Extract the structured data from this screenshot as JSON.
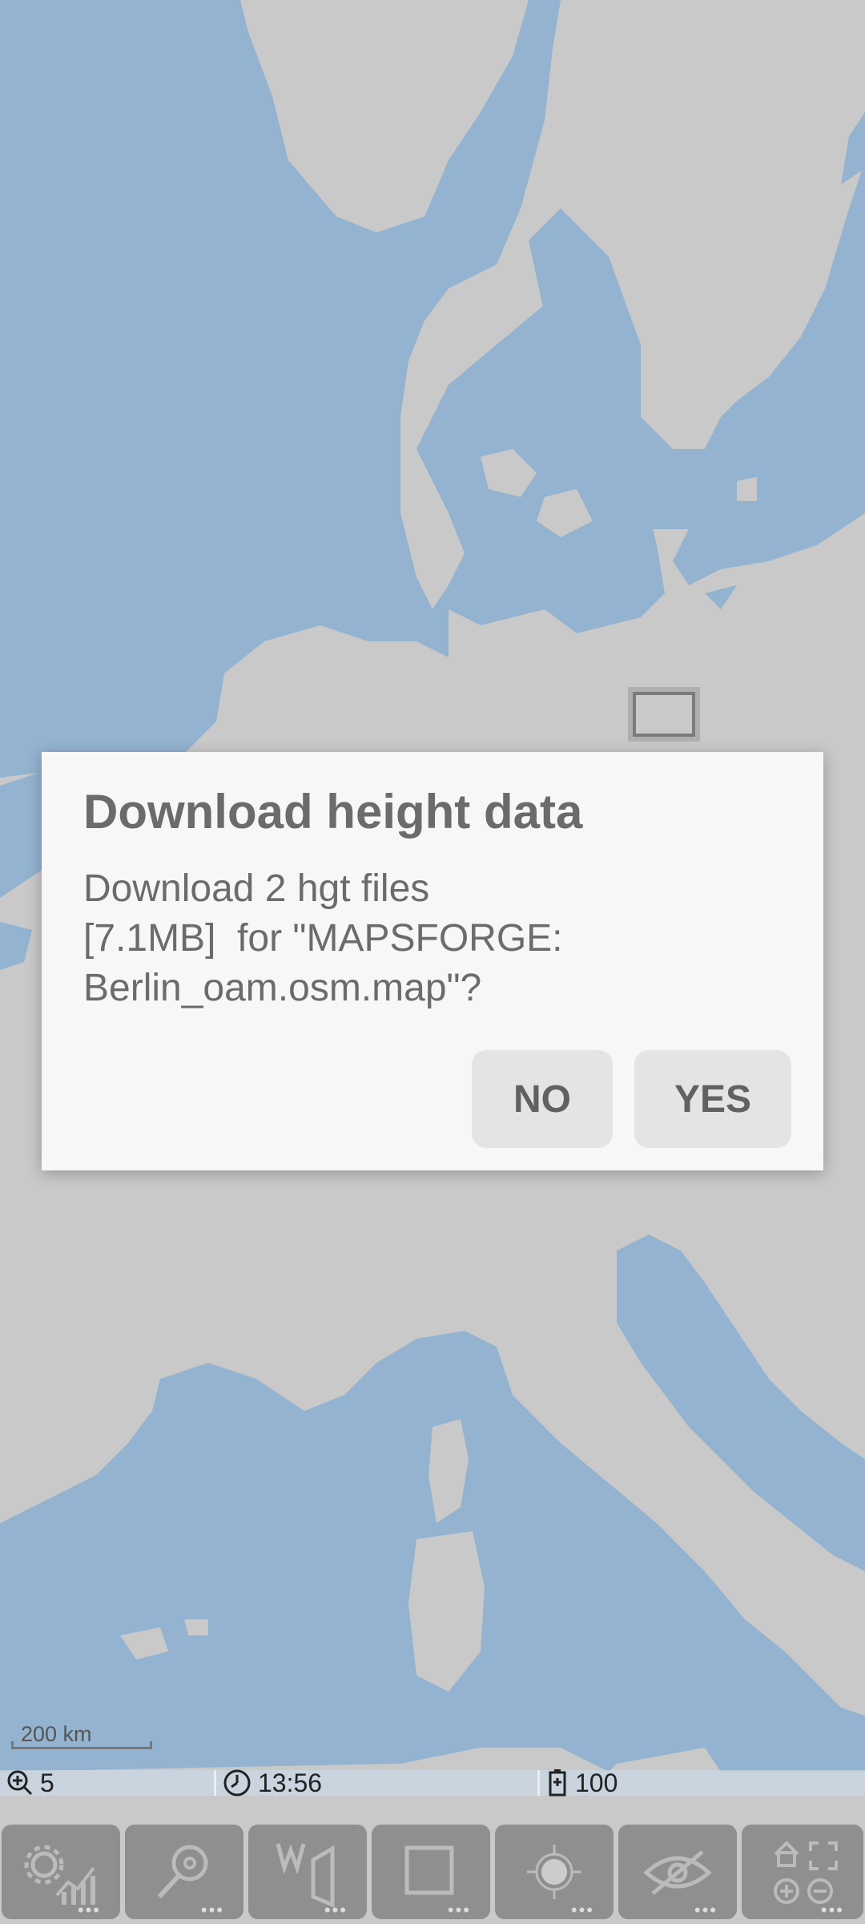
{
  "map": {
    "scale_label": "200 km",
    "colors": {
      "land": "#c9c9c9",
      "water": "#93b3d0"
    }
  },
  "status_bar": {
    "zoom_icon": "zoom-level-icon",
    "zoom_value": "5",
    "clock_icon": "clock-icon",
    "time": "13:56",
    "battery_icon": "battery-icon",
    "battery": "100"
  },
  "toolbar": {
    "buttons": [
      {
        "icon": "settings-chart-icon"
      },
      {
        "icon": "search-icon"
      },
      {
        "icon": "waypoint-route-icon"
      },
      {
        "icon": "square-frame-icon"
      },
      {
        "icon": "location-target-icon"
      },
      {
        "icon": "eye-off-icon"
      },
      {
        "icon": "home-zoom-icon"
      }
    ]
  },
  "dialog": {
    "title": "Download height data",
    "message": "Download 2 hgt files\n[7.1MB]  for \"MAPSFORGE:\nBerlin_oam.osm.map\"?",
    "no_label": "NO",
    "yes_label": "YES"
  }
}
